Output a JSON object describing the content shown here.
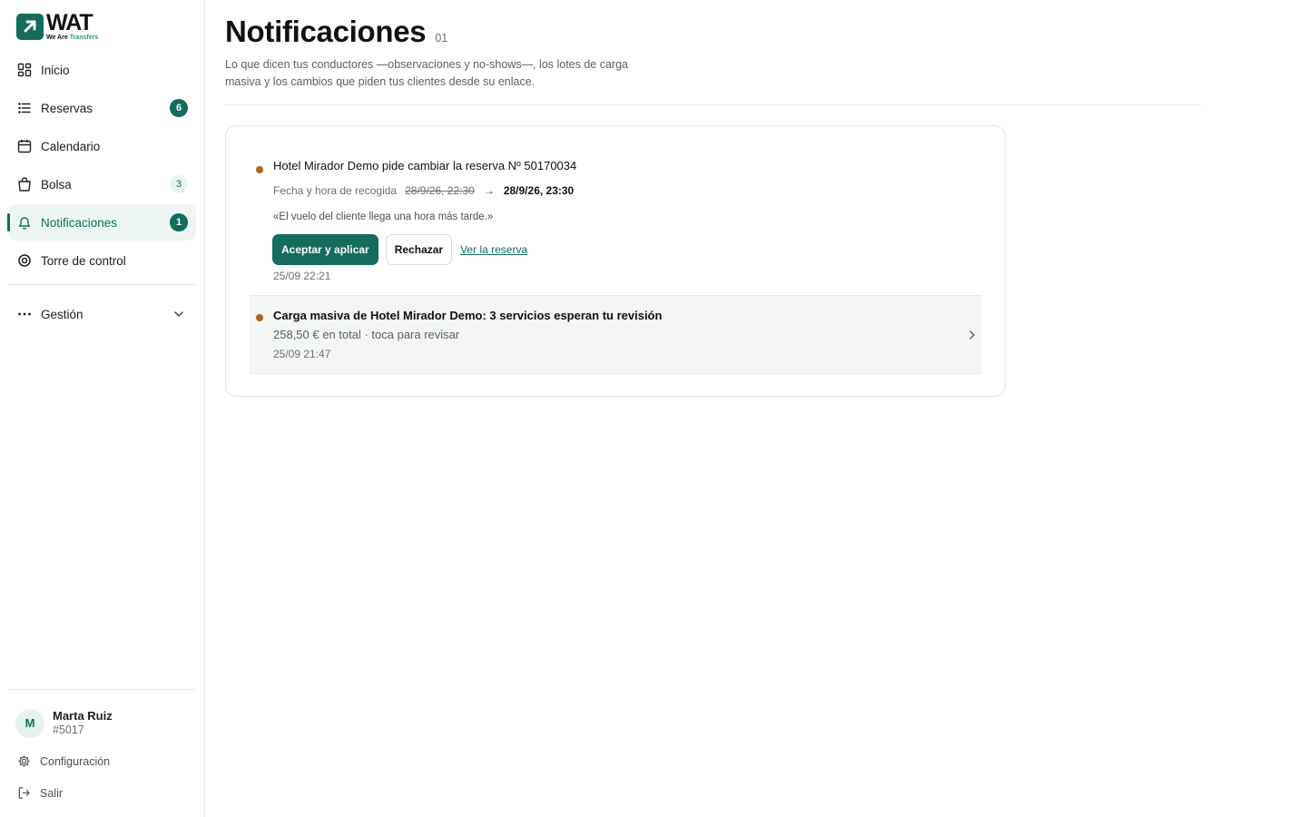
{
  "brand": {
    "name": "WAT",
    "tagline_prefix": "We Are",
    "tagline_accent": "Transfers",
    "accent_color": "#146b5e"
  },
  "sidebar": {
    "items": [
      {
        "label": "Inicio",
        "icon": "dashboard-icon"
      },
      {
        "label": "Reservas",
        "icon": "list-icon",
        "badge": "6"
      },
      {
        "label": "Calendario",
        "icon": "calendar-icon"
      },
      {
        "label": "Bolsa",
        "icon": "bag-icon",
        "badge": "3"
      },
      {
        "label": "Notificaciones",
        "icon": "bell-icon",
        "badge": "1",
        "active": true
      },
      {
        "label": "Torre de control",
        "icon": "target-icon"
      }
    ],
    "gestion_label": "Gestión"
  },
  "user": {
    "initial": "M",
    "name": "Marta Ruiz",
    "id": "#5017"
  },
  "footer": {
    "settings_label": "Configuración",
    "logout_label": "Salir"
  },
  "page": {
    "title": "Notificaciones",
    "count": "01",
    "subtitle": "Lo que dicen tus conductores —observaciones y no‑shows—, los lotes de carga masiva y los cambios que piden tus clientes desde su enlace."
  },
  "notifications": [
    {
      "title": "Hotel Mirador Demo pide cambiar la reserva Nº 50170034",
      "field_label": "Fecha y hora de recogida",
      "old_value": "28/9/26, 22:30",
      "arrow": "→",
      "new_value": "28/9/26, 23:30",
      "quote": "«El vuelo del cliente llega una hora más tarde.»",
      "accept_label": "Aceptar y aplicar",
      "reject_label": "Rechazar",
      "view_label": "Ver la reserva",
      "time": "25/09 22:21",
      "dot_color": "#b0611c"
    },
    {
      "title": "Carga masiva de Hotel Mirador Demo: 3 servicios esperan tu revisión",
      "subtitle": "258,50 € en total · toca para revisar",
      "time": "25/09 21:47",
      "dot_color": "#b0611c"
    }
  ]
}
